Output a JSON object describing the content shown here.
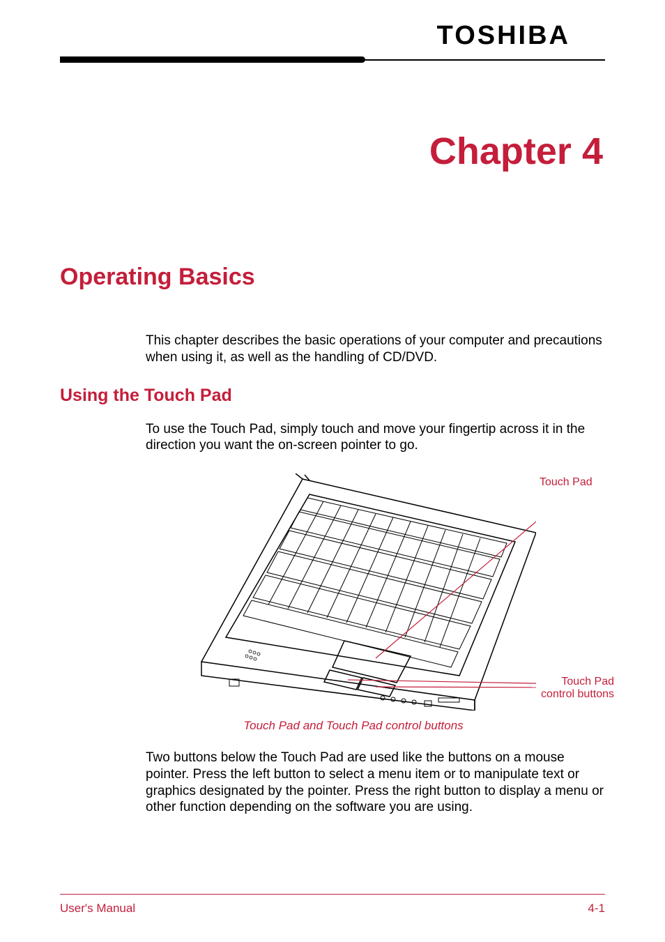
{
  "header": {
    "logo": "TOSHIBA"
  },
  "chapter": {
    "title": "Chapter 4"
  },
  "section": {
    "title": "Operating Basics",
    "intro": "This chapter describes the basic operations of your computer and precautions when using it, as well as the handling of CD/DVD."
  },
  "subsection": {
    "title": "Using the Touch Pad",
    "text1": "To use the Touch Pad, simply touch and move your fingertip across it in the direction you want the on-screen pointer to go.",
    "text2": "Two buttons below the Touch Pad are used like the buttons on a mouse pointer. Press the left button to select a menu item or to manipulate text or graphics designated by the pointer. Press the right button to display a menu or other function depending on the software you are using."
  },
  "figure": {
    "label_touchpad": "Touch Pad",
    "label_buttons": "Touch Pad control buttons",
    "caption": "Touch Pad and Touch Pad control buttons"
  },
  "footer": {
    "left": "User's Manual",
    "right": "4-1"
  }
}
